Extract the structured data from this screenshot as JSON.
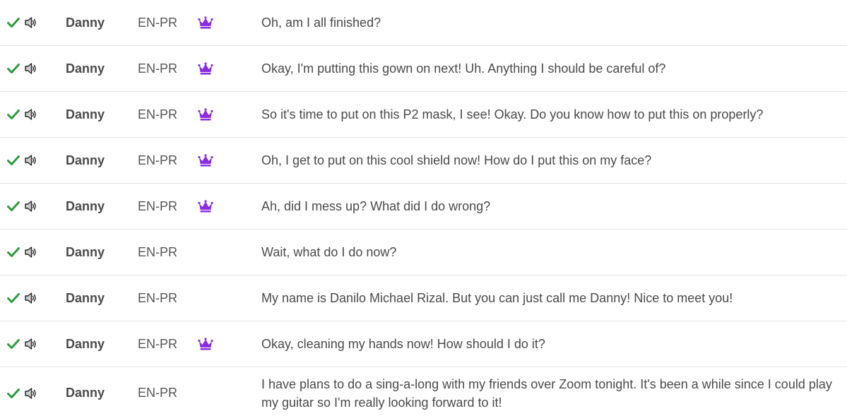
{
  "colors": {
    "check": "#2e9a3e",
    "crown": "#8a2be2",
    "divider": "#e2e2e2",
    "text": "#4a4a4a"
  },
  "rows": [
    {
      "speaker": "Danny",
      "lang": "EN-PR",
      "featured": true,
      "text": "Oh, am I all finished?"
    },
    {
      "speaker": "Danny",
      "lang": "EN-PR",
      "featured": true,
      "text": "Okay, I'm putting this gown on next! Uh. Anything I should be careful of?"
    },
    {
      "speaker": "Danny",
      "lang": "EN-PR",
      "featured": true,
      "text": "So it's time to put on this P2 mask, I see! Okay. Do you know how to put this on properly?"
    },
    {
      "speaker": "Danny",
      "lang": "EN-PR",
      "featured": true,
      "text": "Oh, I get to put on this cool shield now! How do I put this on my face?"
    },
    {
      "speaker": "Danny",
      "lang": "EN-PR",
      "featured": true,
      "text": "Ah, did I mess up? What did I do wrong?"
    },
    {
      "speaker": "Danny",
      "lang": "EN-PR",
      "featured": false,
      "text": "Wait, what do I do now?"
    },
    {
      "speaker": "Danny",
      "lang": "EN-PR",
      "featured": false,
      "text": "My name is Danilo Michael Rizal. But you can just call me Danny! Nice to meet you!"
    },
    {
      "speaker": "Danny",
      "lang": "EN-PR",
      "featured": true,
      "text": "Okay, cleaning my hands now! How should I do it?"
    },
    {
      "speaker": "Danny",
      "lang": "EN-PR",
      "featured": false,
      "text": "I have plans to do a sing-a-long with my friends over Zoom tonight. It's been a while since I could play my guitar so I'm really looking forward to it!"
    }
  ]
}
